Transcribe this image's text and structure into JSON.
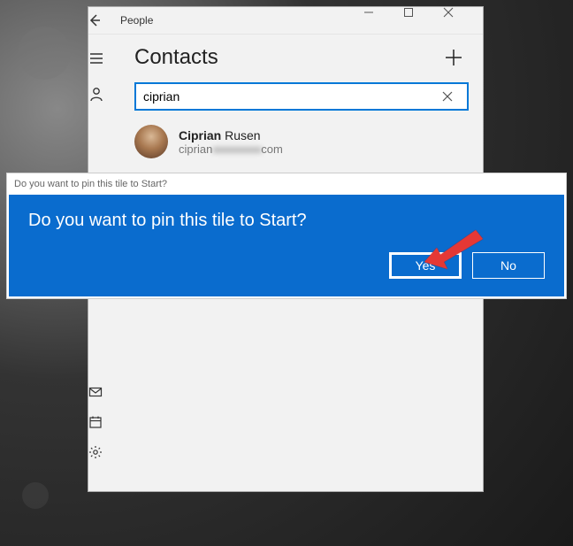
{
  "window": {
    "title": "People",
    "heading": "Contacts"
  },
  "search": {
    "value": "ciprian"
  },
  "result": {
    "name_match": "Ciprian",
    "name_rest": " Rusen",
    "email_prefix": "ciprian",
    "email_hidden": "xxxxxxxxxx",
    "email_suffix": "com"
  },
  "dialog": {
    "caption": "Do you want to pin this tile to Start?",
    "question": "Do you want to pin this tile to Start?",
    "yes": "Yes",
    "no": "No"
  }
}
